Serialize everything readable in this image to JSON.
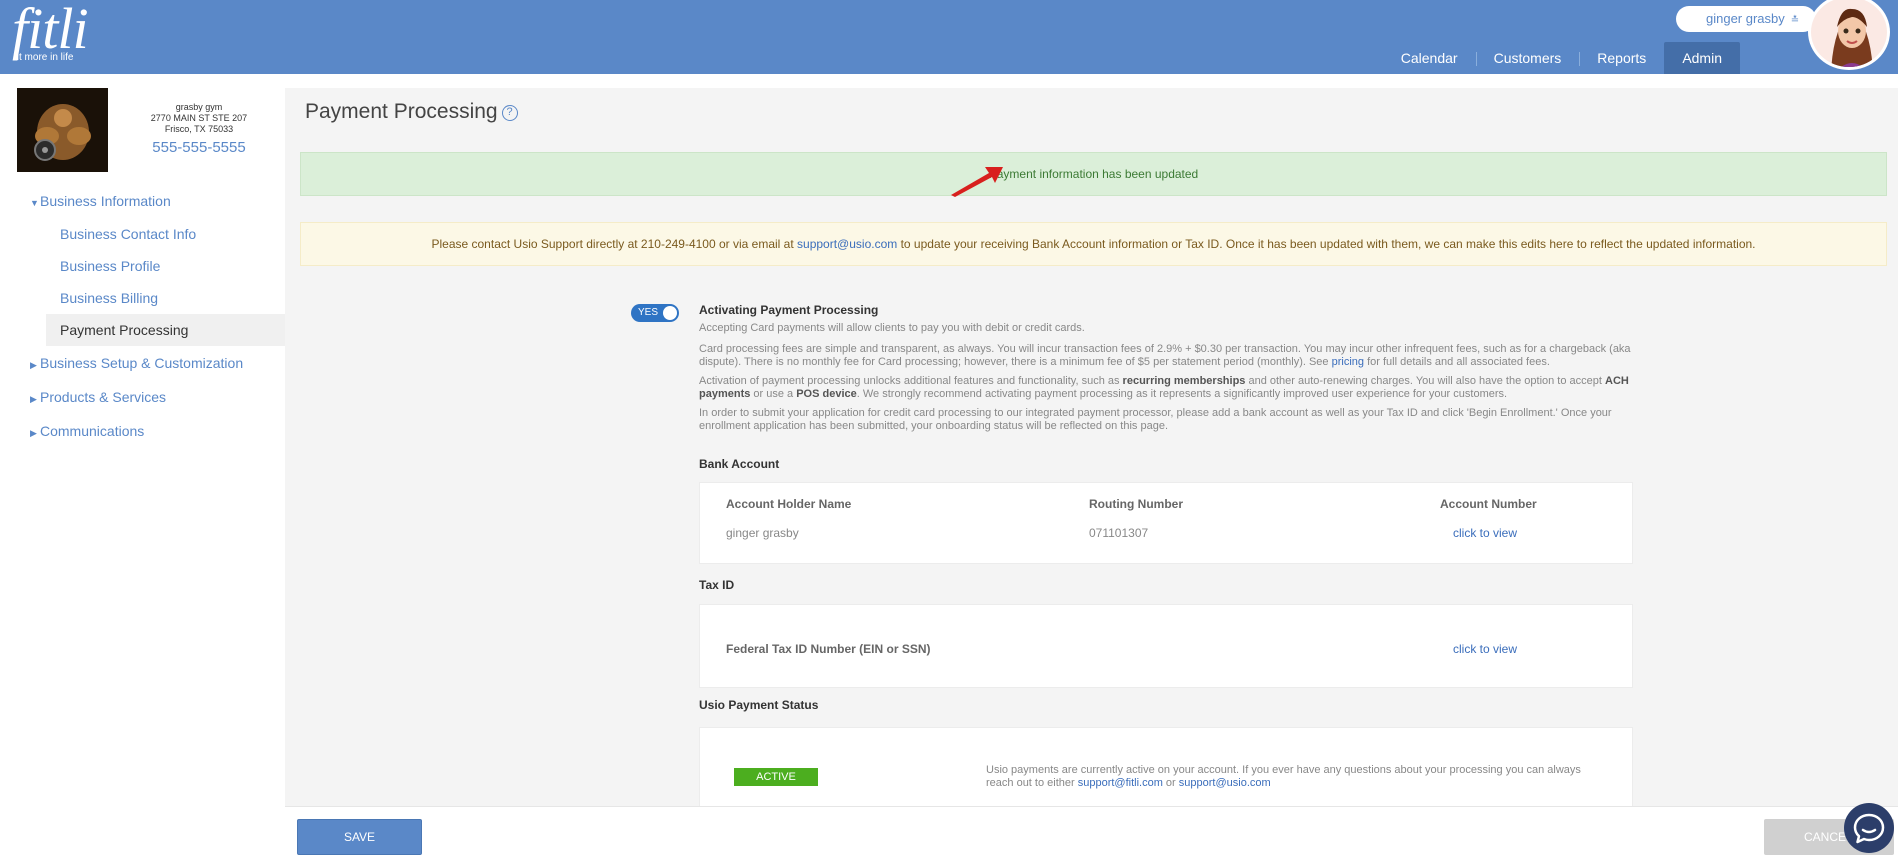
{
  "header": {
    "logo": "fitli",
    "tagline": "fit more in life",
    "user_name": "ginger grasby",
    "nav": [
      "Calendar",
      "Customers",
      "Reports",
      "Admin"
    ]
  },
  "business": {
    "name": "grasby gym",
    "address1": "2770 MAIN ST STE 207",
    "address2": "Frisco, TX 75033",
    "phone": "555-555-5555"
  },
  "sidebar": {
    "items": [
      {
        "label": "Business Information"
      },
      {
        "label": "Business Contact Info"
      },
      {
        "label": "Business Profile"
      },
      {
        "label": "Business Billing"
      },
      {
        "label": "Payment Processing"
      },
      {
        "label": "Business Setup & Customization"
      },
      {
        "label": "Products & Services"
      },
      {
        "label": "Communications"
      }
    ]
  },
  "page": {
    "title": "Payment Processing",
    "help": "?",
    "success_message": "Payment information has been updated",
    "warning": {
      "pre": "Please contact Usio Support directly at 210-249-4100 or via email at ",
      "email": "support@usio.com",
      "post": " to update your receiving Bank Account information or Tax ID. Once it has been updated with them, we can make this edits here to reflect the updated information."
    },
    "toggle_label": "YES",
    "activating_heading": "Activating Payment Processing",
    "para1": "Accepting Card payments will allow clients to pay you with debit or credit cards.",
    "para2_pre": "Card processing fees are simple and transparent, as always. You will incur transaction fees of 2.9% + $0.30 per transaction. You may incur other infrequent fees, such as for a chargeback (aka dispute). There is no monthly fee for Card processing; however, there is a minimum fee of $5 per statement period (monthly). See ",
    "para2_link": "pricing",
    "para2_post": " for full details and all associated fees.",
    "para3_a": "Activation of payment processing unlocks additional features and functionality, such as ",
    "para3_b": "recurring memberships",
    "para3_c": " and other auto-renewing charges. You will also have the option to accept ",
    "para3_d": "ACH payments",
    "para3_e": " or use a ",
    "para3_f": "POS device",
    "para3_g": ". We strongly recommend activating payment processing as it represents a significantly improved user experience for your customers.",
    "para4": "In order to submit your application for credit card processing to our integrated payment processor, please add a bank account as well as your Tax ID and click 'Begin Enrollment.' Once your enrollment application has been submitted, your onboarding status will be reflected on this page.",
    "bank": {
      "heading": "Bank Account",
      "col_holder": "Account Holder Name",
      "col_routing": "Routing Number",
      "col_account": "Account Number",
      "holder": "ginger grasby",
      "routing": "071101307",
      "account_link": "click to view"
    },
    "tax": {
      "heading": "Tax ID",
      "label": "Federal Tax ID Number (EIN or SSN)",
      "link": "click to view"
    },
    "status": {
      "heading": "Usio Payment Status",
      "badge": "ACTIVE",
      "text": "Usio payments are currently active on your account. If you ever have any questions about your processing you can always reach out to either ",
      "email1": "support@fitli.com",
      "or": " or ",
      "email2": "support@usio.com"
    }
  },
  "footer": {
    "save": "SAVE",
    "cancel": "CANCEL"
  }
}
